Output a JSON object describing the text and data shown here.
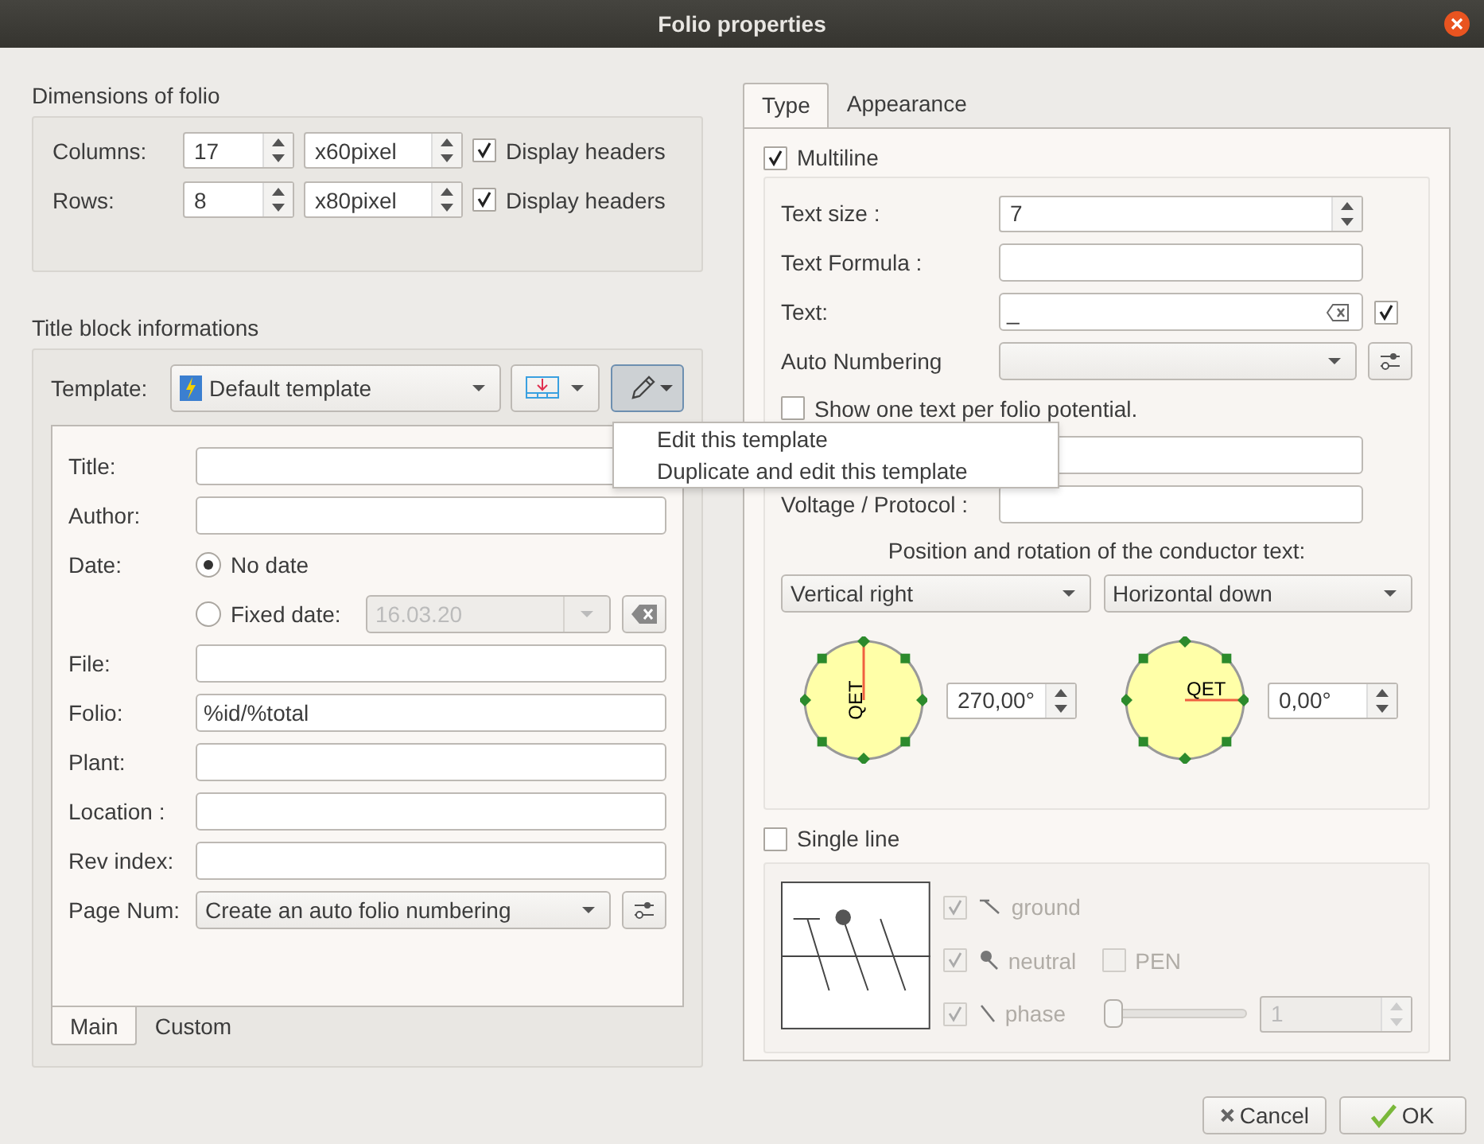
{
  "window": {
    "title": "Folio properties"
  },
  "dimensions": {
    "title": "Dimensions of folio",
    "rows": [
      {
        "label": "Columns:",
        "count": "17",
        "size": "x60pixel",
        "headers": {
          "label": "Display headers",
          "checked": true
        }
      },
      {
        "label": "Rows:",
        "count": "8",
        "size": "x80pixel",
        "headers": {
          "label": "Display headers",
          "checked": true
        }
      }
    ]
  },
  "title_block": {
    "title": "Title block informations",
    "template_label": "Template:",
    "template": "Default template",
    "menu": {
      "items": [
        "Edit this template",
        "Duplicate and edit this template"
      ]
    },
    "fields": [
      {
        "kind": "text",
        "label": "Title:"
      },
      {
        "kind": "text",
        "label": "Author:"
      },
      {
        "kind": "date",
        "label": "Date:",
        "options": [
          {
            "label": "No date",
            "selected": true
          },
          {
            "label": "Fixed date:",
            "selected": false
          }
        ],
        "date": {
          "value": "16.03.20",
          "disabled": true
        }
      },
      {
        "kind": "text",
        "label": "File:"
      },
      {
        "kind": "text",
        "label": "Folio:",
        "value": "%id/%total"
      },
      {
        "kind": "text",
        "label": "Plant:"
      },
      {
        "kind": "text",
        "label": "Location :"
      },
      {
        "kind": "text",
        "label": "Rev index:"
      },
      {
        "kind": "combo",
        "label": "Page Num:",
        "value": "Create an auto folio numbering"
      }
    ],
    "tabs": [
      {
        "label": "Main",
        "selected": true
      },
      {
        "label": "Custom",
        "selected": false
      }
    ]
  },
  "conductor": {
    "tabs": [
      {
        "label": "Type",
        "selected": true
      },
      {
        "label": "Appearance",
        "selected": false
      }
    ],
    "multiline": {
      "label": "Multiline",
      "checked": true
    },
    "fields": [
      {
        "kind": "spin",
        "label": "Text size :",
        "value": "7"
      },
      {
        "kind": "text",
        "label": "Text Formula :"
      },
      {
        "kind": "clearable",
        "label": "Text:",
        "value": "_",
        "checked": true
      },
      {
        "kind": "combo",
        "label": "Auto Numbering"
      },
      {
        "kind": "check",
        "label": "Show one text per folio potential.",
        "checked": false
      },
      {
        "kind": "text"
      },
      {
        "kind": "text",
        "label": "Voltage / Protocol :"
      }
    ],
    "position": {
      "title": "Position and rotation of the conductor text:",
      "combos": [
        "Vertical right",
        "Horizontal down"
      ],
      "dials": [
        {
          "kind": "vertical",
          "label": "QET",
          "angle": "270,00°"
        },
        {
          "kind": "horizontal",
          "label": "QET",
          "angle": "0,00°"
        }
      ]
    },
    "single_line": {
      "label": "Single line",
      "checked": false,
      "rows": [
        {
          "items": [
            {
              "kind": "ground",
              "label": "ground",
              "checked": true,
              "disabled": true
            }
          ]
        },
        {
          "items": [
            {
              "kind": "neutral",
              "label": "neutral",
              "checked": true,
              "disabled": true
            },
            {
              "kind": "plain",
              "label": "PEN",
              "checked": false,
              "disabled": true
            }
          ]
        },
        {
          "items": [
            {
              "kind": "phase",
              "label": "phase",
              "checked": true,
              "disabled": true
            },
            {
              "kind": "slider",
              "level": 0,
              "disabled": true
            },
            {
              "kind": "spin",
              "value": "1",
              "disabled": true
            }
          ]
        }
      ]
    }
  },
  "buttons": [
    {
      "kind": "cancel",
      "label": "Cancel"
    },
    {
      "kind": "ok",
      "label": "OK"
    }
  ]
}
